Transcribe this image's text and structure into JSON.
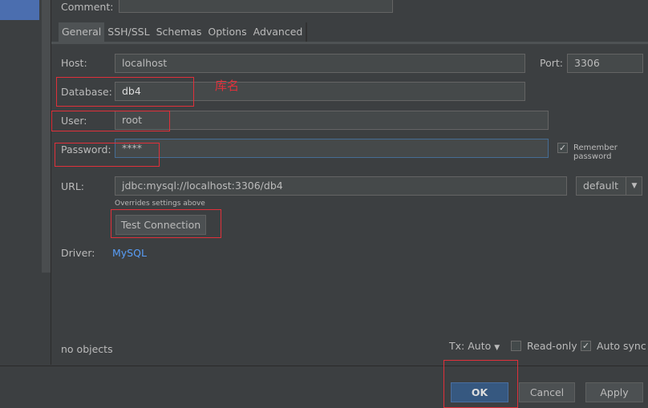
{
  "comment_label": "Comment:",
  "tabs": [
    "General",
    "SSH/SSL",
    "Schemas",
    "Options",
    "Advanced"
  ],
  "host": {
    "label": "Host:",
    "value": "localhost"
  },
  "port": {
    "label": "Port:",
    "value": "3306"
  },
  "database": {
    "label": "Database:",
    "value": "db4",
    "annotation": "库名"
  },
  "user": {
    "label": "User:",
    "value": "root"
  },
  "password": {
    "label": "Password:",
    "value": "****",
    "remember_label": "Remember password",
    "remember_checked": true
  },
  "url": {
    "label": "URL:",
    "value": "jdbc:mysql://localhost:3306/db4",
    "hint": "Overrides settings above",
    "mode": "default"
  },
  "test_connection": "Test Connection",
  "driver": {
    "label": "Driver:",
    "value": "MySQL"
  },
  "status": "no objects",
  "tx": "Tx: Auto",
  "read_only": {
    "label": "Read-only",
    "checked": false
  },
  "auto_sync": {
    "label": "Auto sync",
    "checked": true
  },
  "buttons": {
    "ok": "OK",
    "cancel": "Cancel",
    "apply": "Apply"
  },
  "colors": {
    "annotation": "#e0303a",
    "link": "#589df6",
    "ok": "#365880"
  }
}
